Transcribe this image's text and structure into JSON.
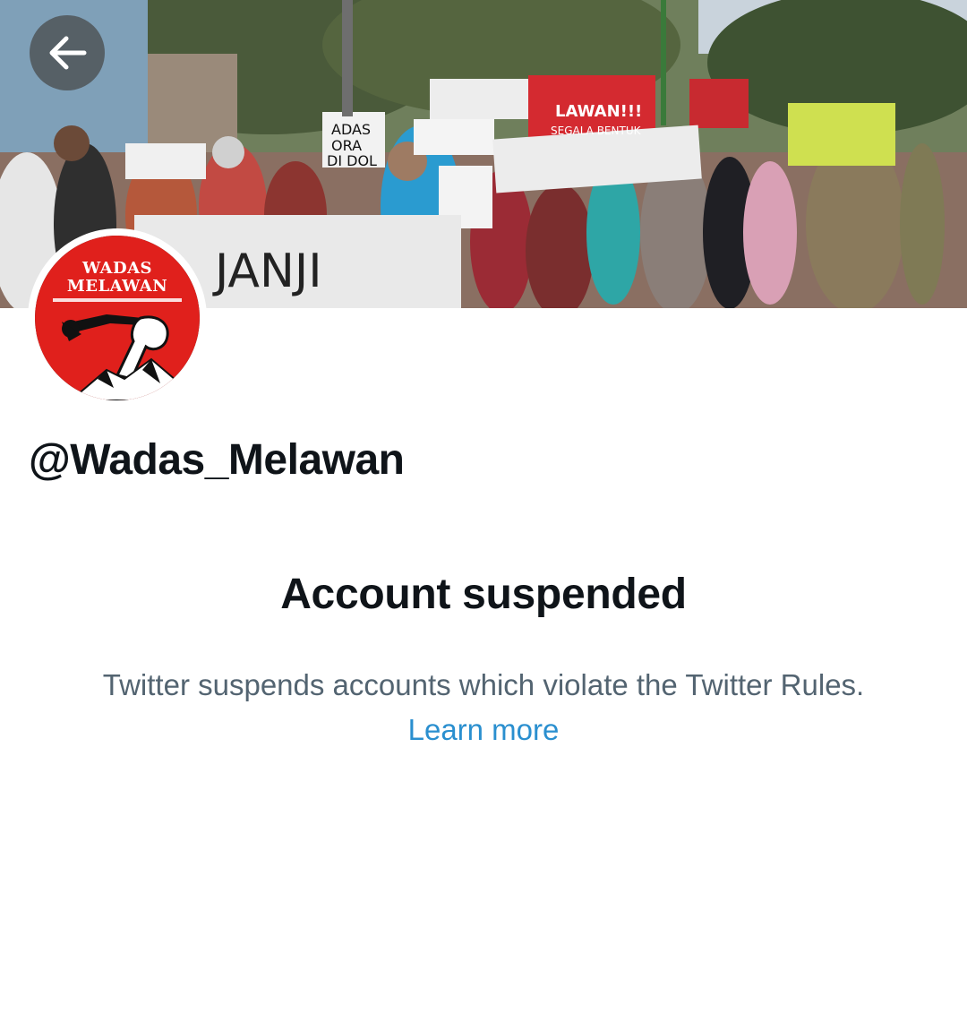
{
  "header": {
    "back_icon": "arrow-left-icon"
  },
  "profile": {
    "avatar_logo_lines": [
      "WADAS",
      "MELAWAN"
    ],
    "handle": "@Wadas_Melawan"
  },
  "suspension": {
    "title": "Account suspended",
    "message": "Twitter suspends accounts which violate the Twitter Rules.",
    "learn_more_label": "Learn more"
  },
  "colors": {
    "text_primary": "#0f1419",
    "text_secondary": "#536471",
    "link": "#2a8fcf",
    "avatar_red": "#e0201c"
  }
}
